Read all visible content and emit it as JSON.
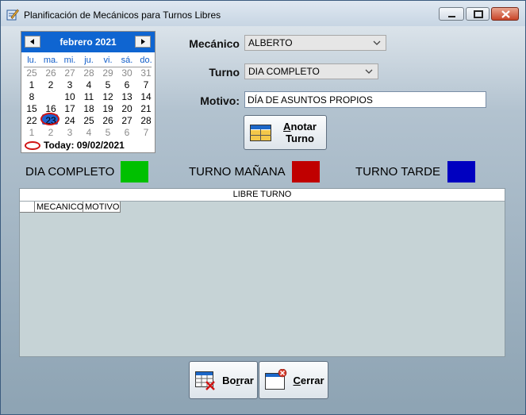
{
  "window": {
    "title": "Planificación de Mecánicos para Turnos Libres",
    "icon": "pencil-form-icon"
  },
  "calendar": {
    "month_label": "febrero 2021",
    "weekdays": [
      "lu.",
      "ma.",
      "mi.",
      "ju.",
      "vi.",
      "sá.",
      "do."
    ],
    "weeks": [
      [
        {
          "d": "25",
          "o": true
        },
        {
          "d": "26",
          "o": true
        },
        {
          "d": "27",
          "o": true
        },
        {
          "d": "28",
          "o": true
        },
        {
          "d": "29",
          "o": true
        },
        {
          "d": "30",
          "o": true
        },
        {
          "d": "31",
          "o": true
        }
      ],
      [
        {
          "d": "1"
        },
        {
          "d": "2"
        },
        {
          "d": "3"
        },
        {
          "d": "4"
        },
        {
          "d": "5"
        },
        {
          "d": "6"
        },
        {
          "d": "7"
        }
      ],
      [
        {
          "d": "8"
        },
        {
          "d": "9",
          "s": true
        },
        {
          "d": "10"
        },
        {
          "d": "11"
        },
        {
          "d": "12"
        },
        {
          "d": "13"
        },
        {
          "d": "14"
        }
      ],
      [
        {
          "d": "15"
        },
        {
          "d": "16"
        },
        {
          "d": "17"
        },
        {
          "d": "18"
        },
        {
          "d": "19"
        },
        {
          "d": "20"
        },
        {
          "d": "21"
        }
      ],
      [
        {
          "d": "22"
        },
        {
          "d": "23"
        },
        {
          "d": "24"
        },
        {
          "d": "25"
        },
        {
          "d": "26"
        },
        {
          "d": "27"
        },
        {
          "d": "28"
        }
      ],
      [
        {
          "d": "1",
          "o": true
        },
        {
          "d": "2",
          "o": true
        },
        {
          "d": "3",
          "o": true
        },
        {
          "d": "4",
          "o": true
        },
        {
          "d": "5",
          "o": true
        },
        {
          "d": "6",
          "o": true
        },
        {
          "d": "7",
          "o": true
        }
      ]
    ],
    "today_label": "Today: 09/02/2021"
  },
  "form": {
    "mecanico_label": "Mecánico",
    "mecanico_value": "ALBERTO",
    "turno_label": "Turno",
    "turno_value": "DIA COMPLETO",
    "motivo_label": "Motivo:",
    "motivo_value": "DÍA DE ASUNTOS PROPIOS",
    "anotar_button": {
      "mnemonic": "A",
      "rest": "notar",
      "line2": "Turno"
    }
  },
  "legend": [
    {
      "label": "DIA COMPLETO",
      "color": "#00c000"
    },
    {
      "label": "TURNO MAÑANA",
      "color": "#c00000"
    },
    {
      "label": "TURNO TARDE",
      "color": "#0000c0"
    }
  ],
  "grid": {
    "title": "LIBRE TURNO",
    "columns": [
      "MECANICO",
      "MOTIVO"
    ]
  },
  "buttons": {
    "borrar": {
      "pre": "Bo",
      "mnemonic": "r",
      "post": "rar"
    },
    "cerrar": {
      "pre": "",
      "mnemonic": "C",
      "post": "errar"
    }
  }
}
